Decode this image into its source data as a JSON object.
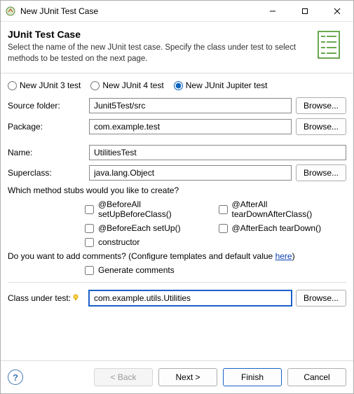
{
  "titlebar": {
    "title": "New JUnit Test Case"
  },
  "banner": {
    "heading": "JUnit Test Case",
    "description": "Select the name of the new JUnit test case. Specify the class under test to select methods to be tested on the next page."
  },
  "radios": {
    "junit3": "New JUnit 3 test",
    "junit4": "New JUnit 4 test",
    "jupiter": "New JUnit Jupiter test",
    "selected": "jupiter"
  },
  "fields": {
    "source_folder": {
      "label": "Source folder:",
      "value": "Junit5Test/src",
      "browse": "Browse..."
    },
    "package": {
      "label": "Package:",
      "value": "com.example.test",
      "browse": "Browse..."
    },
    "name": {
      "label": "Name:",
      "value": "UtilitiesTest"
    },
    "superclass": {
      "label": "Superclass:",
      "value": "java.lang.Object",
      "browse": "Browse..."
    },
    "class_under_test": {
      "label": "Class under test:",
      "value": "com.example.utils.Utilities",
      "browse": "Browse..."
    }
  },
  "stubs": {
    "question": "Which method stubs would you like to create?",
    "before_all": "@BeforeAll setUpBeforeClass()",
    "after_all": "@AfterAll tearDownAfterClass()",
    "before_each": "@BeforeEach setUp()",
    "after_each": "@AfterEach tearDown()",
    "constructor": "constructor"
  },
  "comments": {
    "question_pre": "Do you want to add comments? (Configure templates and default value ",
    "link": "here",
    "question_post": ")",
    "generate": "Generate comments"
  },
  "buttons": {
    "help_tooltip": "Help",
    "back": "< Back",
    "next": "Next >",
    "finish": "Finish",
    "cancel": "Cancel"
  }
}
